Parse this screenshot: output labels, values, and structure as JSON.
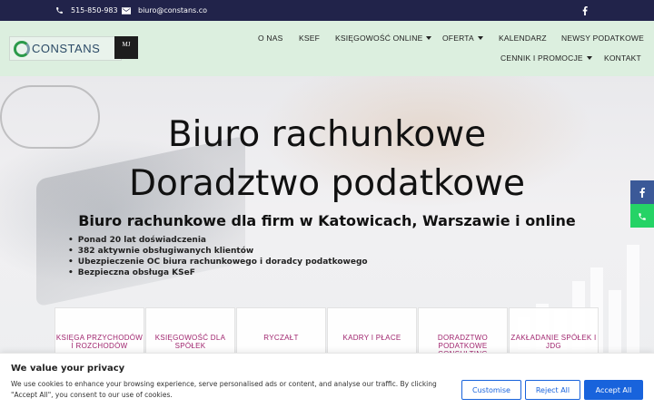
{
  "topbar": {
    "phone": "515-850-983",
    "email": "biuro@constans.co",
    "phone_icon": "phone-icon",
    "email_icon": "envelope-icon",
    "social_icon": "facebook-icon"
  },
  "header": {
    "logo_text": "CONSTANS",
    "badge_text": "MJ"
  },
  "nav": {
    "items": [
      {
        "label": "O NAS",
        "dropdown": false
      },
      {
        "label": "KSEF",
        "dropdown": false
      },
      {
        "label": "KSIĘGOWOŚĆ ONLINE",
        "dropdown": true
      },
      {
        "label": "OFERTA",
        "dropdown": true
      },
      {
        "label": "KALENDARZ",
        "dropdown": false
      },
      {
        "label": "NEWSY PODATKOWE",
        "dropdown": false
      },
      {
        "label": "CENNIK I PROMOCJE",
        "dropdown": true
      },
      {
        "label": "KONTAKT",
        "dropdown": false
      }
    ]
  },
  "hero": {
    "title_line1": "Biuro rachunkowe",
    "title_line2": "Doradztwo podatkowe",
    "subtitle": "Biuro rachunkowe dla firm w Katowicach, Warszawie i online",
    "bullets": [
      "Ponad 20 lat doświadczenia",
      "382 aktywnie obsługiwanych klientów",
      "Ubezpieczenie OC biura rachunkowego i doradcy podatkowego",
      "Bezpieczna obsługa KSeF"
    ]
  },
  "cards": [
    "KSIĘGA PRZYCHODÓW I ROZCHODÓW",
    "KSIĘGOWOŚĆ DLA SPÓŁEK",
    "RYCZAŁT",
    "KADRY I PŁACE",
    "DORADZTWO PODATKOWE CONSULTING",
    "ZAKŁADANIE SPÓŁEK I JDG"
  ],
  "side": {
    "facebook_color": "#3b5998",
    "phone_color": "#25d366"
  },
  "cookie": {
    "title": "We value your privacy",
    "text": "We use cookies to enhance your browsing experience, serve personalised ads or content, and analyse our traffic. By clicking \"Accept All\", you consent to our use of cookies.",
    "customise": "Customise",
    "reject": "Reject All",
    "accept": "Accept All",
    "accent": "#1863dc"
  }
}
